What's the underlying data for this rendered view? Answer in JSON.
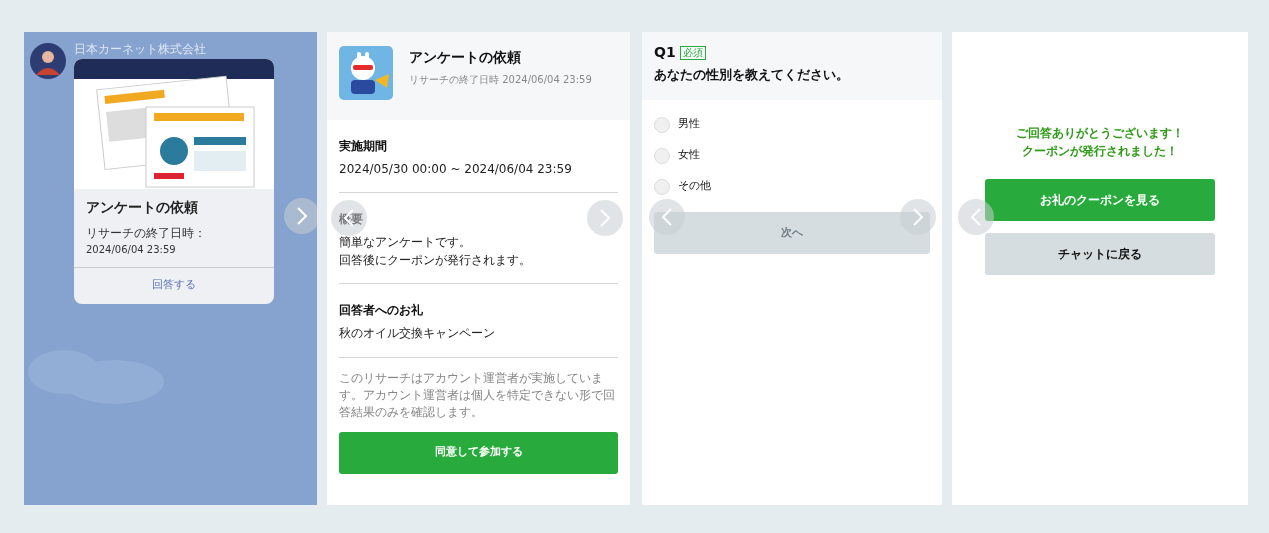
{
  "chat": {
    "sender": "日本カーネット株式会社",
    "card": {
      "title": "アンケートの依頼",
      "subtitle": "リサーチの終了日時：",
      "date": "2024/06/04 23:59",
      "action": "回答する"
    }
  },
  "intro": {
    "title": "アンケートの依頼",
    "deadline": "リサーチの終了日時 2024/06/04 23:59",
    "sections": [
      {
        "heading": "実施期間",
        "lines": [
          "2024/05/30 00:00 ~ 2024/06/04 23:59"
        ]
      },
      {
        "heading": "概要",
        "lines": [
          "簡単なアンケートです。",
          "回答後にクーポンが発行されます。"
        ]
      },
      {
        "heading": "回答者へのお礼",
        "lines": [
          "秋のオイル交換キャンペーン"
        ]
      }
    ],
    "notice": "このリサーチはアカウント運営者が実施しています。アカウント運営者は個人を特定できない形で回答結果のみを確認します。",
    "button": "同意して参加する"
  },
  "question": {
    "number": "Q1",
    "badge": "必須",
    "text": "あなたの性別を教えてください。",
    "options": [
      {
        "label": "男性",
        "selected": false
      },
      {
        "label": "女性",
        "selected": false
      },
      {
        "label": "その他",
        "selected": false
      }
    ],
    "button": {
      "label": "次へ",
      "disabled": true
    }
  },
  "complete": {
    "message": [
      "ご回答ありがとうございます！",
      "クーポンが発行されました！"
    ],
    "buttons": [
      {
        "label": "お礼のクーポンを見る",
        "kind": "primary"
      },
      {
        "label": "チャットに戻る",
        "kind": "secondary"
      }
    ]
  }
}
